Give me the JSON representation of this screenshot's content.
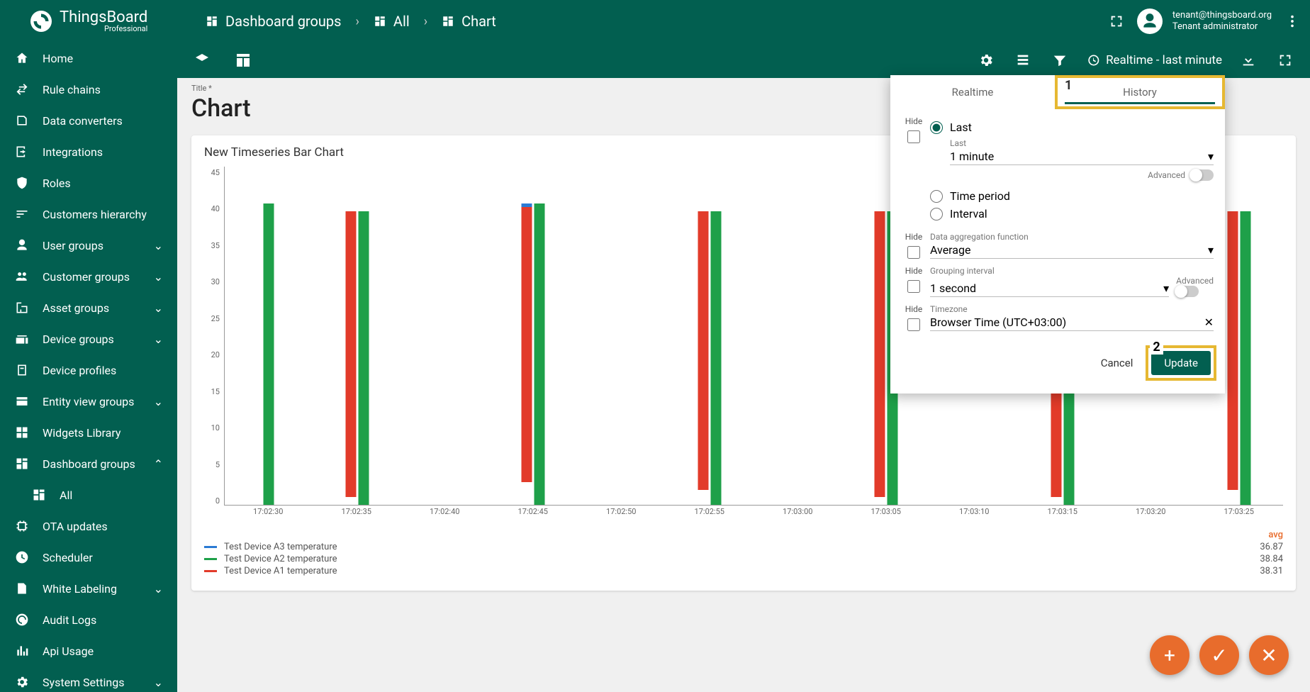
{
  "brand": {
    "name": "ThingsBoard",
    "sub": "Professional"
  },
  "breadcrumbs": [
    "Dashboard groups",
    "All",
    "Chart"
  ],
  "user": {
    "email": "tenant@thingsboard.org",
    "role": "Tenant administrator"
  },
  "nav": [
    {
      "label": "Home",
      "icon": "home"
    },
    {
      "label": "Rule chains",
      "icon": "swap"
    },
    {
      "label": "Data converters",
      "icon": "convert"
    },
    {
      "label": "Integrations",
      "icon": "input"
    },
    {
      "label": "Roles",
      "icon": "shield"
    },
    {
      "label": "Customers hierarchy",
      "icon": "sort"
    },
    {
      "label": "User groups",
      "icon": "user",
      "chev": "down"
    },
    {
      "label": "Customer groups",
      "icon": "group",
      "chev": "down"
    },
    {
      "label": "Asset groups",
      "icon": "domain",
      "chev": "down"
    },
    {
      "label": "Device groups",
      "icon": "devices",
      "chev": "down"
    },
    {
      "label": "Device profiles",
      "icon": "badge"
    },
    {
      "label": "Entity view groups",
      "icon": "view",
      "chev": "down"
    },
    {
      "label": "Widgets Library",
      "icon": "widgets"
    },
    {
      "label": "Dashboard groups",
      "icon": "dashboard",
      "chev": "up"
    },
    {
      "label": "All",
      "icon": "dashboards",
      "sub": true
    },
    {
      "label": "OTA updates",
      "icon": "memory"
    },
    {
      "label": "Scheduler",
      "icon": "schedule"
    },
    {
      "label": "White Labeling",
      "icon": "format",
      "chev": "down"
    },
    {
      "label": "Audit Logs",
      "icon": "trackchanges"
    },
    {
      "label": "Api Usage",
      "icon": "barchart"
    },
    {
      "label": "System Settings",
      "icon": "settings",
      "chev": "down"
    }
  ],
  "toolbar": {
    "realtime": "Realtime - last minute"
  },
  "page": {
    "titleLabel": "Title *",
    "title": "Chart"
  },
  "widget": {
    "title": "New Timeseries Bar Chart"
  },
  "popup": {
    "tab_realtime": "Realtime",
    "tab_history": "History",
    "hide": "Hide",
    "opt_last": "Last",
    "last_label": "Last",
    "last_value": "1 minute",
    "opt_period": "Time period",
    "opt_interval": "Interval",
    "agg_label": "Data aggregation function",
    "agg_value": "Average",
    "grp_label": "Grouping interval",
    "grp_value": "1 second",
    "tz_label": "Timezone",
    "tz_value": "Browser Time (UTC+03:00)",
    "advanced": "Advanced",
    "cancel": "Cancel",
    "update": "Update",
    "annot1": "1",
    "annot2": "2"
  },
  "chart_data": {
    "type": "bar",
    "title": "New Timeseries Bar Chart",
    "xlabel": "",
    "ylabel": "",
    "ylim": [
      0,
      45
    ],
    "yticks": [
      0,
      5,
      10,
      15,
      20,
      25,
      30,
      35,
      40,
      45
    ],
    "categories": [
      "17:02:30",
      "17:02:35",
      "17:02:40",
      "17:02:45",
      "17:02:50",
      "17:02:55",
      "17:03:00",
      "17:03:05",
      "17:03:10",
      "17:03:15",
      "17:03:20",
      "17:03:25"
    ],
    "series": [
      {
        "name": "Test Device A3 temperature",
        "color": "#2b7bd4",
        "values": [
          null,
          null,
          null,
          37,
          null,
          null,
          null,
          null,
          null,
          null,
          null,
          null
        ],
        "avg": 36.87
      },
      {
        "name": "Test Device A2 temperature",
        "color": "#1ea049",
        "values": [
          40,
          39,
          null,
          40,
          null,
          39,
          null,
          39,
          null,
          39,
          null,
          39
        ],
        "avg": 38.84
      },
      {
        "name": "Test Device A1 temperature",
        "color": "#e23b2a",
        "values": [
          null,
          38,
          null,
          37,
          null,
          37,
          null,
          38,
          null,
          38,
          null,
          37
        ],
        "avg": 38.31
      }
    ],
    "legend_header": "avg"
  }
}
